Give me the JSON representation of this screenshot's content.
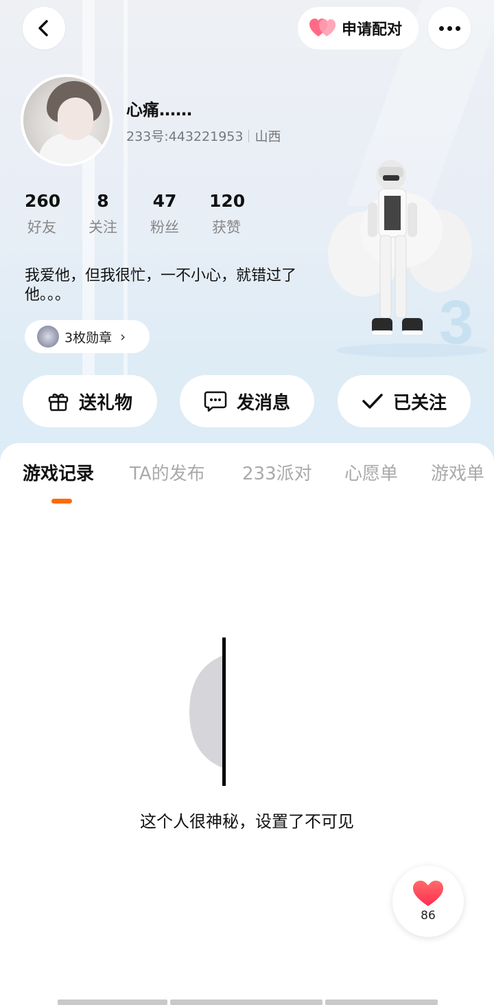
{
  "top_bar": {
    "match_label": "申请配对"
  },
  "profile": {
    "name": "心痛……",
    "id_text": "233号:443221953",
    "location": "山西",
    "bio": "我爱他，但我很忙，一不小心，就错过了他。。。",
    "badge_label": "3枚勋章"
  },
  "stats": [
    {
      "value": "260",
      "label": "好友"
    },
    {
      "value": "8",
      "label": "关注"
    },
    {
      "value": "47",
      "label": "粉丝"
    },
    {
      "value": "120",
      "label": "获赞"
    }
  ],
  "actions": {
    "gift": "送礼物",
    "message": "发消息",
    "follow": "已关注"
  },
  "tabs": [
    "游戏记录",
    "TA的发布",
    "233派对",
    "心愿单",
    "游戏单"
  ],
  "active_tab": "游戏记录",
  "empty_state": {
    "text": "这个人很神秘，设置了不可见"
  },
  "like": {
    "count": "86"
  },
  "colors": {
    "accent": "#ff6a00",
    "heart": "#ff4d5e"
  }
}
